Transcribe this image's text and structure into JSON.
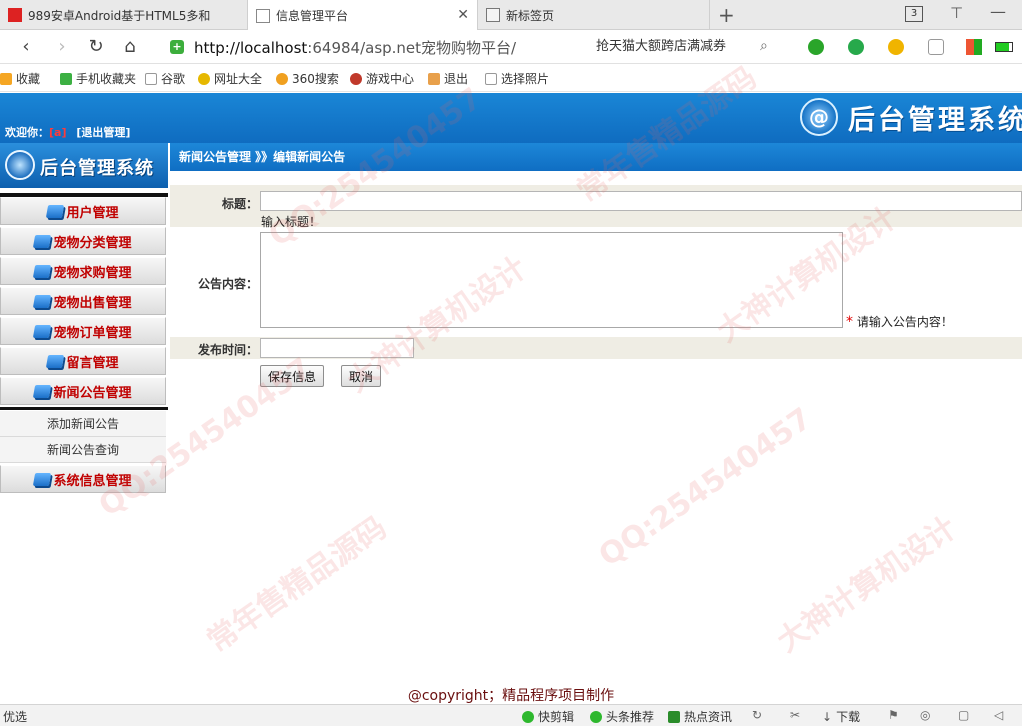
{
  "browser": {
    "tabs": [
      {
        "title": "989安卓Android基于HTML5多和"
      },
      {
        "title": "信息管理平台"
      },
      {
        "title": "新标签页"
      }
    ],
    "tab_count": "3",
    "url_host": "http://localhost",
    "url_rest": ":64984/asp.net宠物购物平台/",
    "search_text": "抢天猫大额跨店满减券",
    "bookmarks": [
      "收藏",
      "手机收藏夹",
      "谷歌",
      "网址大全",
      "360搜索",
      "游戏中心",
      "退出",
      "选择照片"
    ]
  },
  "header": {
    "welcome_prefix": "欢迎你：",
    "username": "[a]",
    "logout": "[退出管理]",
    "system_title": "后台管理系统",
    "logo_letter": "@"
  },
  "sidebar": {
    "logo_title": "后台管理系统",
    "menus": [
      {
        "label": "用户管理"
      },
      {
        "label": "宠物分类管理"
      },
      {
        "label": "宠物求购管理"
      },
      {
        "label": "宠物出售管理"
      },
      {
        "label": "宠物订单管理"
      },
      {
        "label": "留言管理"
      },
      {
        "label": "新闻公告管理"
      }
    ],
    "submenu": [
      "添加新闻公告",
      "新闻公告查询"
    ],
    "last_menu": {
      "label": "系统信息管理"
    }
  },
  "breadcrumb": "新闻公告管理 》》编辑新闻公告",
  "form": {
    "title_label": "标题：",
    "title_value": "",
    "title_hint": "输入标题！",
    "content_label": "公告内容：",
    "content_value": "",
    "content_star": "*",
    "content_hint": "请输入公告内容！",
    "time_label": "发布时间：",
    "time_value": "",
    "save_button": "保存信息",
    "cancel_button": "取消"
  },
  "footer": "@copyright；精品程序项目制作",
  "statusbar": {
    "left": "优选",
    "items": [
      "快剪辑",
      "头条推荐",
      "热点资讯",
      "下载"
    ]
  },
  "watermark_texts": [
    "QQ:254540457",
    "大神计算机设计",
    "常年售精品源码"
  ]
}
